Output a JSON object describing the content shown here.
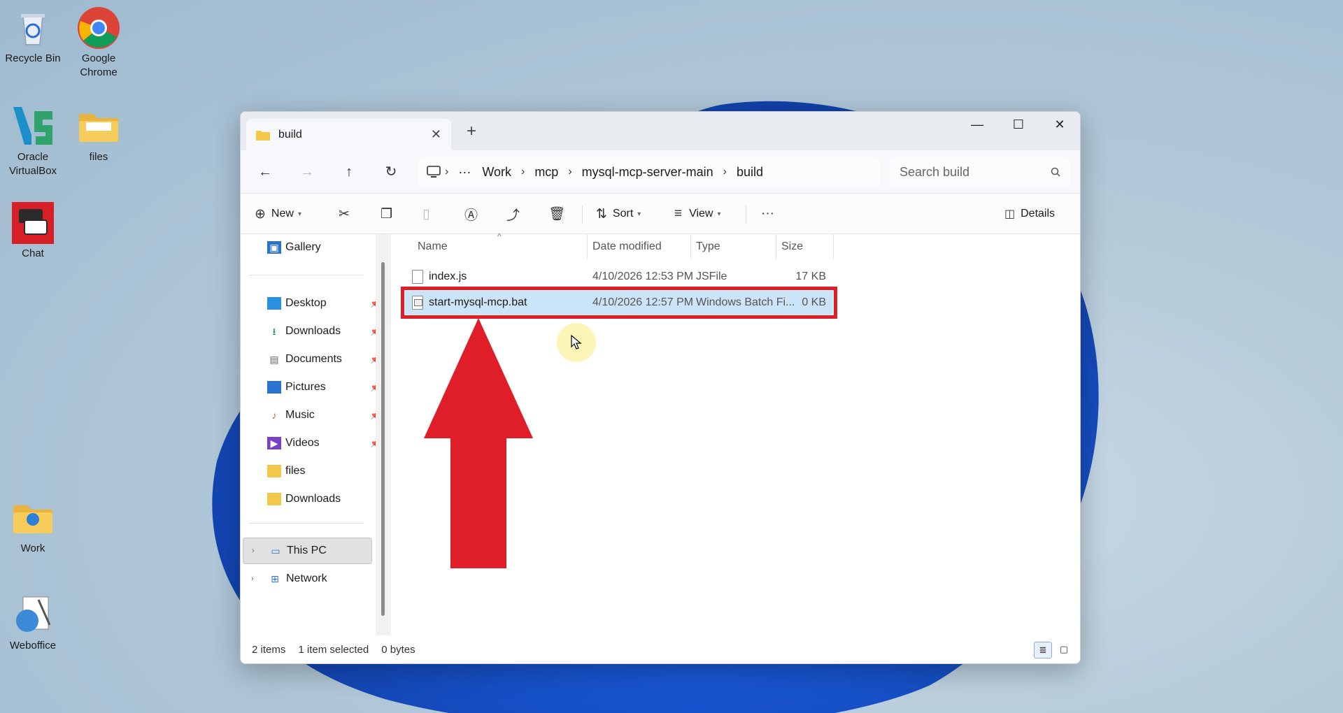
{
  "desktop": {
    "icons": [
      {
        "label": "Recycle Bin"
      },
      {
        "label": "Google Chrome"
      },
      {
        "label": "Oracle VirtualBox"
      },
      {
        "label": "files"
      },
      {
        "label": "Chat"
      },
      {
        "label": "Work"
      },
      {
        "label": "Weboffice"
      }
    ]
  },
  "window": {
    "tab_title": "build",
    "tab_close": "✕",
    "new_tab": "+",
    "controls": {
      "minimize": "—",
      "maximize": "☐",
      "close": "✕"
    }
  },
  "nav": {
    "back": "←",
    "forward": "→",
    "up": "↑",
    "refresh": "↻",
    "ellipsis": "···",
    "breadcrumbs": [
      "Work",
      "mcp",
      "mysql-mcp-server-main",
      "build"
    ],
    "search_placeholder": "Search build"
  },
  "toolbar": {
    "new_label": "New",
    "sort_label": "Sort",
    "view_label": "View",
    "more": "···",
    "details_label": "Details"
  },
  "sidebar": {
    "gallery": "Gallery",
    "quick_access": [
      {
        "label": "Desktop",
        "pinned": true
      },
      {
        "label": "Downloads",
        "pinned": true
      },
      {
        "label": "Documents",
        "pinned": true
      },
      {
        "label": "Pictures",
        "pinned": true
      },
      {
        "label": "Music",
        "pinned": true
      },
      {
        "label": "Videos",
        "pinned": true
      },
      {
        "label": "files",
        "pinned": false
      },
      {
        "label": "Downloads",
        "pinned": false
      }
    ],
    "this_pc": "This PC",
    "network": "Network"
  },
  "columns": {
    "name": "Name",
    "date": "Date modified",
    "type": "Type",
    "size": "Size"
  },
  "files": [
    {
      "name": "index.js",
      "date": "4/10/2026 12:53 PM",
      "type": "JSFile",
      "size": "17 KB",
      "selected": false
    },
    {
      "name": "start-mysql-mcp.bat",
      "date": "4/10/2026 12:57 PM",
      "type": "Windows Batch Fi...",
      "size": "0 KB",
      "selected": true
    }
  ],
  "status": {
    "items": "2 items",
    "selected": "1 item selected",
    "bytes": "0 bytes"
  },
  "colors": {
    "annotation_red": "#e01e2a",
    "selection_blue": "#cce4f7",
    "folder_yellow": "#f3c747"
  }
}
